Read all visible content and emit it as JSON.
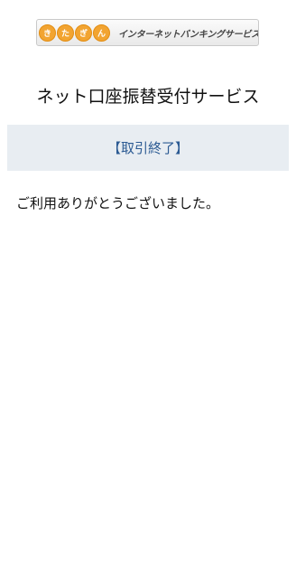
{
  "header": {
    "logo_bubbles": [
      "き",
      "た",
      "ぎ",
      "ん"
    ],
    "logo_text": "インターネットバンキングサービス",
    "logo_bubble_color": "#f2a431"
  },
  "page": {
    "title": "ネット口座振替受付サービス",
    "status": "【取引終了】",
    "message": "ご利用ありがとうございました。"
  },
  "colors": {
    "status_band_bg": "#e8edf2",
    "status_text": "#2b5a93"
  }
}
